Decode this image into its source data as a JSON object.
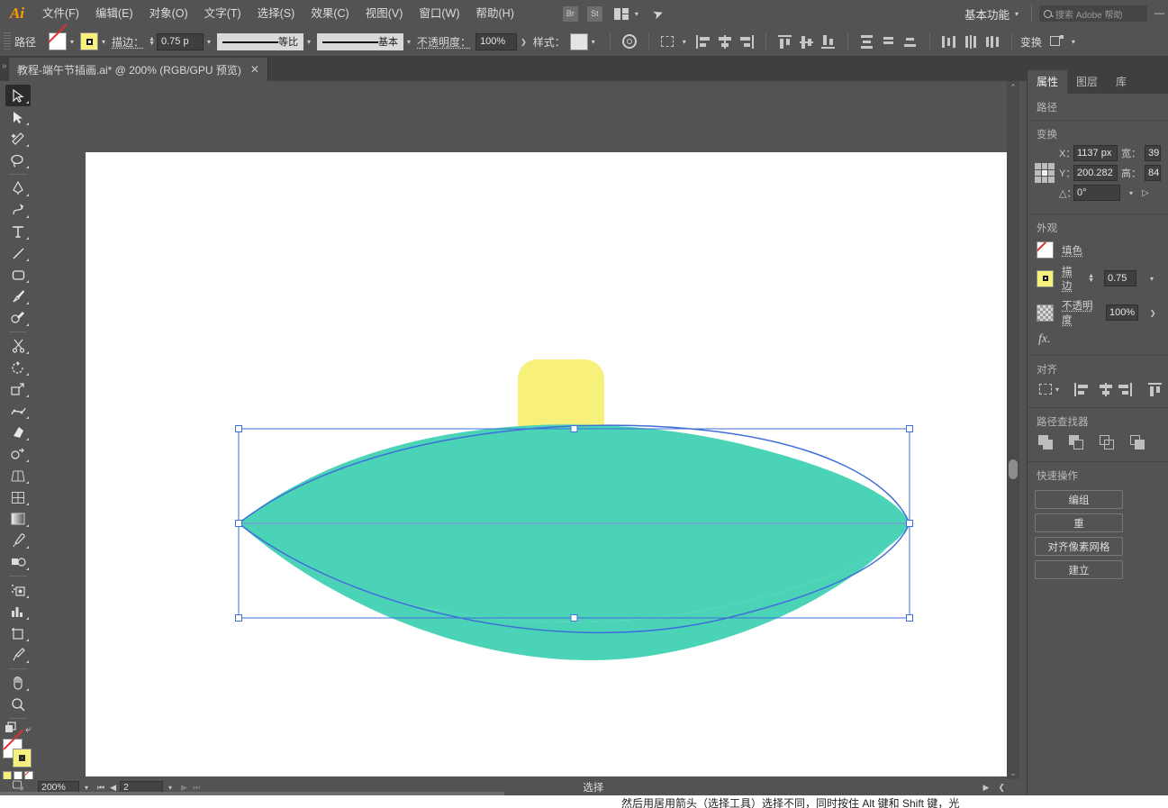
{
  "app": {
    "name": "Adobe Illustrator",
    "logo": "Ai"
  },
  "menubar": {
    "items": [
      {
        "label": "文件(F)",
        "name": "menu-file"
      },
      {
        "label": "编辑(E)",
        "name": "menu-edit"
      },
      {
        "label": "对象(O)",
        "name": "menu-object"
      },
      {
        "label": "文字(T)",
        "name": "menu-type"
      },
      {
        "label": "选择(S)",
        "name": "menu-select"
      },
      {
        "label": "效果(C)",
        "name": "menu-effect"
      },
      {
        "label": "视图(V)",
        "name": "menu-view"
      },
      {
        "label": "窗口(W)",
        "name": "menu-window"
      },
      {
        "label": "帮助(H)",
        "name": "menu-help"
      }
    ],
    "bridge_button": "Br",
    "stock_button": "St",
    "workspace": "基本功能",
    "search_placeholder": "搜索 Adobe 帮助"
  },
  "controlbar": {
    "object_label": "路径",
    "fill_swatch": "none",
    "stroke_swatch_color": "#f6f07d",
    "stroke_label": "描边：",
    "stroke_weight": "0.75 p",
    "profile_label": "等比",
    "brush_label": "基本",
    "opacity_label": "不透明度：",
    "opacity_value": "100%",
    "style_label": "样式：",
    "transform_label": "变换"
  },
  "tabbar": {
    "document_title": "教程-端午节插画.ai* @ 200% (RGB/GPU 预览)",
    "close": "✕"
  },
  "toolbar": {
    "tools": [
      {
        "name": "selection-tool",
        "label": "选择工具",
        "selected": true
      },
      {
        "name": "direct-selection-tool",
        "label": "直接选择工具"
      },
      {
        "name": "magic-wand-tool",
        "label": "魔棒工具"
      },
      {
        "name": "lasso-tool",
        "label": "套索工具"
      },
      {
        "name": "pen-tool",
        "label": "钢笔工具"
      },
      {
        "name": "curvature-tool",
        "label": "曲率工具"
      },
      {
        "name": "type-tool",
        "label": "文字工具"
      },
      {
        "name": "line-segment-tool",
        "label": "直线段工具"
      },
      {
        "name": "rectangle-tool",
        "label": "矩形工具"
      },
      {
        "name": "paintbrush-tool",
        "label": "画笔工具"
      },
      {
        "name": "shaper-tool",
        "label": "Shaper 工具"
      },
      {
        "name": "scissors-tool",
        "label": "剪刀工具"
      },
      {
        "name": "rotate-tool",
        "label": "旋转工具"
      },
      {
        "name": "scale-tool",
        "label": "比例缩放工具"
      },
      {
        "name": "width-tool",
        "label": "宽度工具"
      },
      {
        "name": "free-transform-tool",
        "label": "自由变换工具"
      },
      {
        "name": "shape-builder-tool",
        "label": "形状生成器工具"
      },
      {
        "name": "perspective-grid-tool",
        "label": "透视网格工具"
      },
      {
        "name": "mesh-tool",
        "label": "网格工具"
      },
      {
        "name": "gradient-tool",
        "label": "渐变工具"
      },
      {
        "name": "eyedropper-tool",
        "label": "吸管工具"
      },
      {
        "name": "blend-tool",
        "label": "混合工具"
      },
      {
        "name": "symbol-sprayer-tool",
        "label": "符号喷枪工具"
      },
      {
        "name": "column-graph-tool",
        "label": "柱形图工具"
      },
      {
        "name": "artboard-tool",
        "label": "画板工具"
      },
      {
        "name": "slice-tool",
        "label": "切片工具"
      },
      {
        "name": "hand-tool",
        "label": "抓手工具"
      },
      {
        "name": "zoom-tool",
        "label": "缩放工具"
      }
    ]
  },
  "canvas": {
    "yellow_shape_color": "#f7f07b",
    "leaf_fill_color": "#4bd3b8",
    "leaf_stroke_color": "#3a7fd5",
    "selection_color": "#3f6fd8",
    "artboard_background": "#ffffff"
  },
  "statusbar": {
    "zoom": "200%",
    "page": "2",
    "status_text": "选择"
  },
  "rightpanel": {
    "tabs": [
      {
        "label": "属性",
        "active": true
      },
      {
        "label": "图层",
        "active": false
      },
      {
        "label": "库",
        "active": false
      }
    ],
    "object_type": "路径",
    "transform": {
      "title": "变换",
      "x_label": "X：",
      "x_value": "1137 px",
      "y_label": "Y：",
      "y_value": "200.282",
      "w_label": "宽：",
      "w_value": "39",
      "h_label": "高：",
      "h_value": "84",
      "angle_label": "△：",
      "angle_value": "0°"
    },
    "appearance": {
      "title": "外观",
      "fill_label": "填色",
      "stroke_label": "描边",
      "stroke_value": "0.75",
      "opacity_label": "不透明度",
      "opacity_value": "100%",
      "fx_label": "fx."
    },
    "align": {
      "title": "对齐"
    },
    "pathfinder": {
      "title": "路径查找器"
    },
    "quick_actions": {
      "title": "快速操作",
      "buttons": [
        "编组",
        "重",
        "对齐像素网格",
        "建立"
      ]
    }
  },
  "caption": {
    "text": "然后用居用箭头（选择工具）选择不同，同时按住 Alt 键和 Shift 键，光"
  }
}
